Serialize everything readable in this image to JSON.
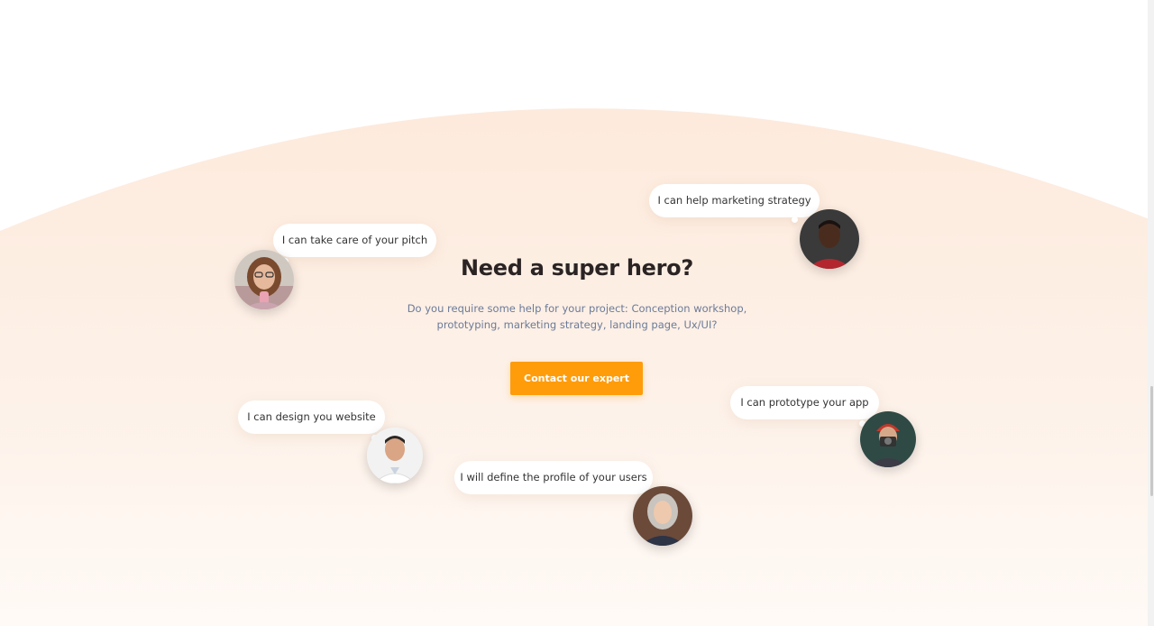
{
  "hero": {
    "title": "Need a super hero?",
    "subtitle": "Do you require some help for your project: Conception workshop, prototyping, marketing strategy, landing page, Ux/UI?",
    "cta_label": "Contact our expert"
  },
  "experts": [
    {
      "message": "I can take care of your pitch"
    },
    {
      "message": "I can help marketing strategy"
    },
    {
      "message": "I can design you website"
    },
    {
      "message": "I can prototype your app"
    },
    {
      "message": "I will define the profile of your users"
    }
  ],
  "colors": {
    "accent": "#ff9c0a",
    "title": "#2b2424",
    "subtitle": "#6b7a99",
    "background_tint": "#fdeee2"
  }
}
